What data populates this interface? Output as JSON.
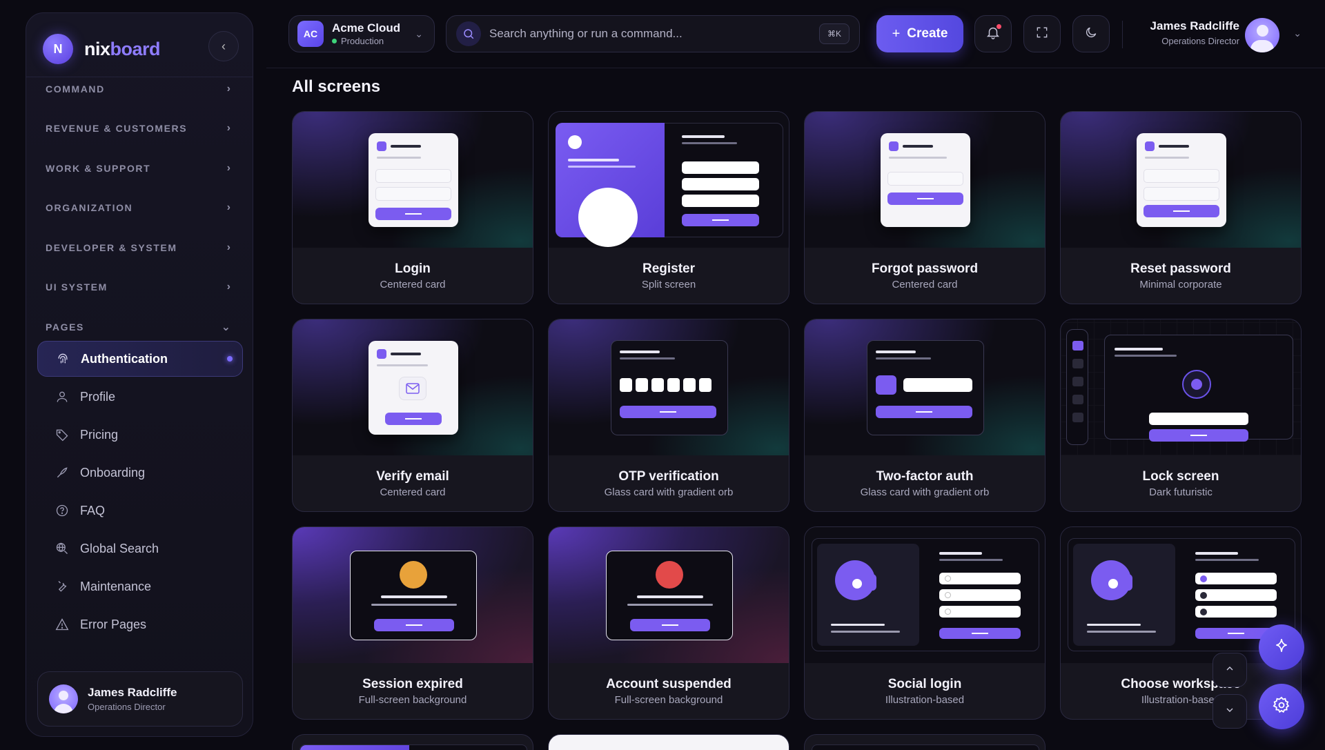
{
  "brand": {
    "initial": "N",
    "name_a": "nix",
    "name_b": "board"
  },
  "sidebar": {
    "sections": [
      {
        "label": "COMMAND"
      },
      {
        "label": "REVENUE & CUSTOMERS"
      },
      {
        "label": "WORK & SUPPORT"
      },
      {
        "label": "ORGANIZATION"
      },
      {
        "label": "DEVELOPER & SYSTEM"
      },
      {
        "label": "UI SYSTEM"
      },
      {
        "label": "PAGES"
      }
    ],
    "items": [
      {
        "label": "Authentication",
        "icon": "fingerprint-icon",
        "active": true
      },
      {
        "label": "Profile",
        "icon": "user-icon"
      },
      {
        "label": "Pricing",
        "icon": "tag-icon"
      },
      {
        "label": "Onboarding",
        "icon": "rocket-icon"
      },
      {
        "label": "FAQ",
        "icon": "help-circle-icon"
      },
      {
        "label": "Global Search",
        "icon": "globe-search-icon"
      },
      {
        "label": "Maintenance",
        "icon": "wrench-icon"
      },
      {
        "label": "Error Pages",
        "icon": "warning-icon"
      }
    ],
    "user": {
      "name": "James Radcliffe",
      "role": "Operations Director"
    }
  },
  "header": {
    "workspace": {
      "initials": "AC",
      "name": "Acme Cloud",
      "env": "Production"
    },
    "search": {
      "placeholder": "Search anything or run a command...",
      "shortcut": "⌘K"
    },
    "create_label": "Create",
    "user": {
      "name": "James Radcliffe",
      "role": "Operations Director"
    }
  },
  "main": {
    "title": "All screens",
    "cards": [
      {
        "title": "Login",
        "subtitle": "Centered card"
      },
      {
        "title": "Register",
        "subtitle": "Split screen"
      },
      {
        "title": "Forgot password",
        "subtitle": "Centered card"
      },
      {
        "title": "Reset password",
        "subtitle": "Minimal corporate"
      },
      {
        "title": "Verify email",
        "subtitle": "Centered card"
      },
      {
        "title": "OTP verification",
        "subtitle": "Glass card with gradient orb"
      },
      {
        "title": "Two-factor auth",
        "subtitle": "Glass card with gradient orb"
      },
      {
        "title": "Lock screen",
        "subtitle": "Dark futuristic"
      },
      {
        "title": "Session expired",
        "subtitle": "Full-screen background"
      },
      {
        "title": "Account suspended",
        "subtitle": "Full-screen background"
      },
      {
        "title": "Social login",
        "subtitle": "Illustration-based"
      },
      {
        "title": "Choose workspace",
        "subtitle": "Illustration-based"
      }
    ]
  },
  "colors": {
    "accent": "#7b5cf0",
    "background": "#0b0a12",
    "card": "#17161f",
    "orange": "#e8a23a",
    "red": "#e24a4a",
    "online": "#3ed47a"
  }
}
